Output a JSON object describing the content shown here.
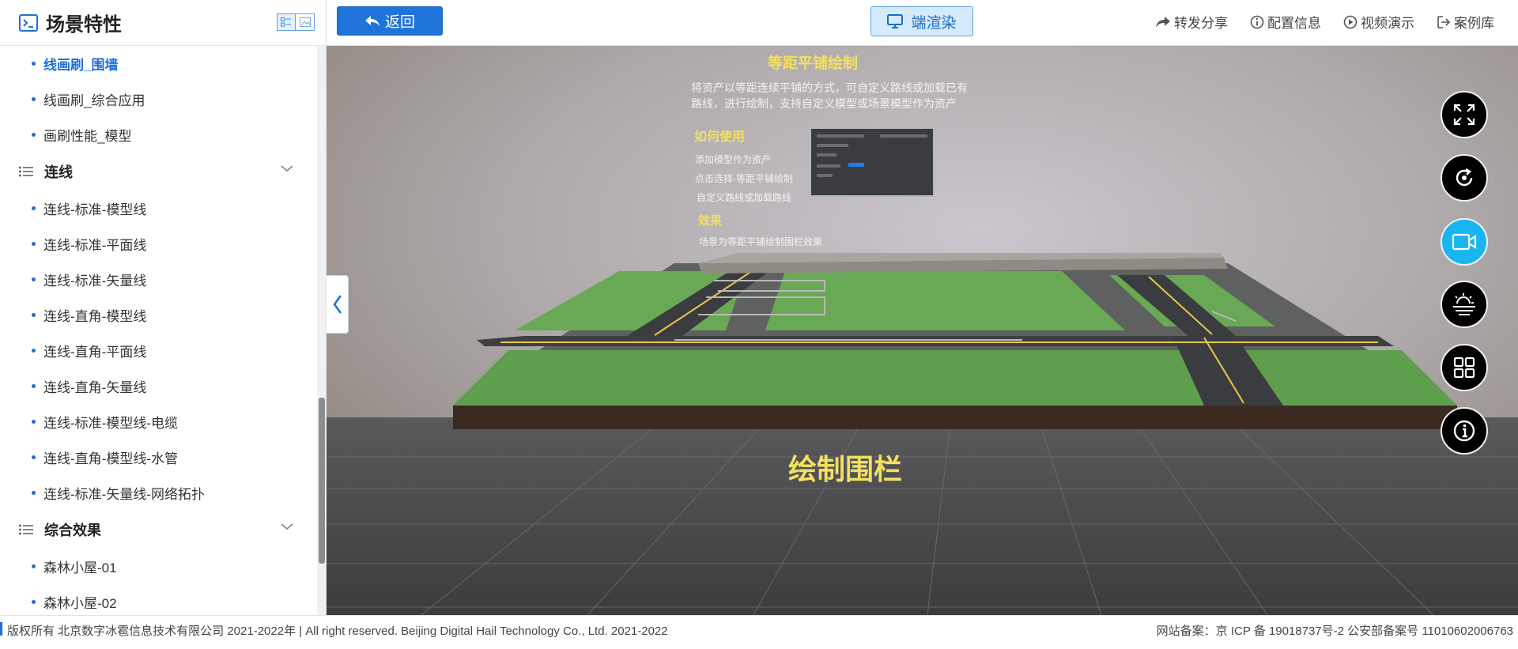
{
  "sidebar": {
    "title": "场景特性",
    "items_top": [
      "线画刷_围墙",
      "线画刷_综合应用",
      "画刷性能_模型"
    ],
    "group_lines": {
      "label": "连线",
      "items": [
        "连线-标准-模型线",
        "连线-标准-平面线",
        "连线-标准-矢量线",
        "连线-直角-模型线",
        "连线-直角-平面线",
        "连线-直角-矢量线",
        "连线-标准-模型线-电缆",
        "连线-直角-模型线-水管",
        "连线-标准-矢量线-网络拓扑"
      ]
    },
    "group_effects": {
      "label": "综合效果",
      "items": [
        "森林小屋-01",
        "森林小屋-02"
      ]
    }
  },
  "toolbar": {
    "back_label": "返回",
    "render_label": "端渲染",
    "links": [
      "转发分享",
      "配置信息",
      "视频演示",
      "案例库"
    ]
  },
  "scene": {
    "title": "等距平铺绘制",
    "desc_line1": "将资产以等距连续平铺的方式，可自定义路线或加载已有",
    "desc_line2": "路线，进行绘制，支持自定义模型或场景模型作为资产",
    "howto_title": "如何使用",
    "howto_1": "添加模型作为资产",
    "howto_2": "点击选择-等距平铺绘制",
    "howto_3": "自定义路线或加载路线",
    "effect_title": "效果",
    "effect_1": "场景为等距平铺绘制围栏效果",
    "bottom_caption": "绘制围栏"
  },
  "footer": {
    "copyright": "版权所有 北京数字冰雹信息技术有限公司 2021-2022年 | All right reserved. Beijing Digital Hail Technology Co., Ltd. 2021-2022",
    "icp": "网站备案：京 ICP 备 19018737号-2 公安部备案号 11010602006763"
  },
  "colors": {
    "accent": "#1e74d8",
    "render_bg": "#d5eafb",
    "active_round": "#18b5f0",
    "grass": "#6aab55"
  }
}
